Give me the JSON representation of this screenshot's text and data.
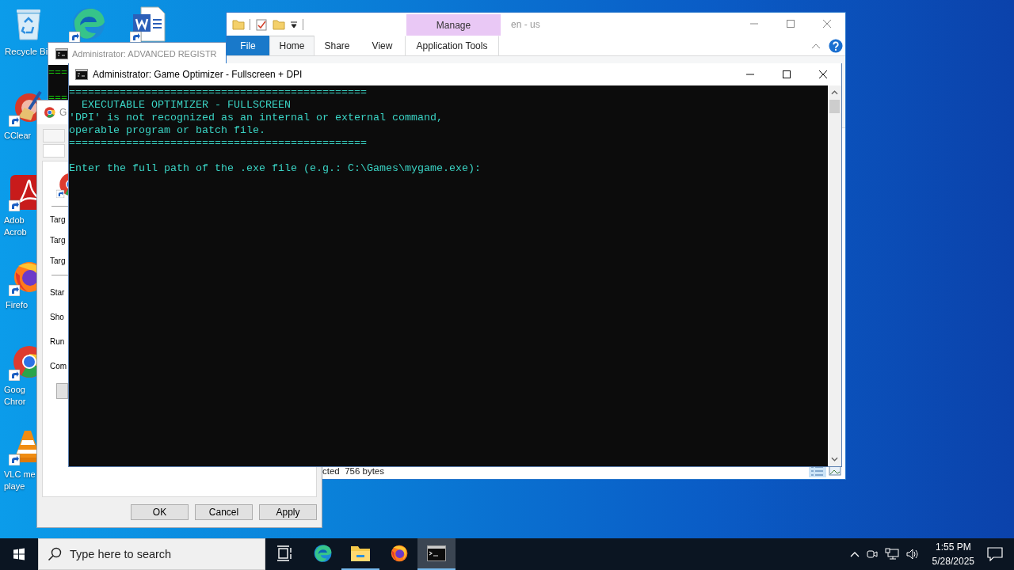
{
  "desktop_icons": [
    {
      "kind": "recycle",
      "lines": [
        "Recycle Bi"
      ]
    },
    {
      "kind": "edge"
    },
    {
      "kind": "word"
    },
    {
      "kind": "ccleaner",
      "lines": [
        "CClear"
      ]
    },
    {
      "kind": "acrobat",
      "lines": [
        "Adob",
        "Acrob"
      ]
    },
    {
      "kind": "firefox",
      "lines": [
        "Firefo"
      ]
    },
    {
      "kind": "chrome",
      "lines": [
        "Goog",
        "Chror"
      ]
    },
    {
      "kind": "vlc",
      "lines": [
        "VLC me",
        "playe"
      ]
    }
  ],
  "explorer": {
    "title": "en - us",
    "contextual_group": "Manage",
    "tabs": [
      {
        "label": "File",
        "kind": "file",
        "selected": false
      },
      {
        "label": "Home",
        "kind": "tab",
        "selected": true
      },
      {
        "label": "Share",
        "kind": "tab",
        "selected": false
      },
      {
        "label": "View",
        "kind": "tab",
        "selected": false
      },
      {
        "label": "Application Tools",
        "kind": "contextual",
        "selected": false
      }
    ],
    "status": "cted  756 bytes"
  },
  "registry_console": {
    "title": "Administrator: ADVANCED REGISTR",
    "lines": [
      "===",
      "==="
    ]
  },
  "properties_dialog": {
    "title": "G",
    "target_fields": [
      "Targ",
      "Targ",
      "Targ"
    ],
    "option_fields": [
      "Star",
      "Sho",
      "Run",
      "Com"
    ],
    "buttons": [
      "OK",
      "Cancel",
      "Apply"
    ]
  },
  "console": {
    "title": "Administrator: Game Optimizer - Fullscreen + DPI",
    "lines": [
      "===============================================",
      "  EXECUTABLE OPTIMIZER - FULLSCREEN",
      "'DPI' is not recognized as an internal or external command,",
      "operable program or batch file.",
      "==============================================="
    ],
    "prompt": "Enter the full path of the .exe file (e.g.: C:\\Games\\mygame.exe):"
  },
  "taskbar": {
    "search": {
      "placeholder": "Type here to search"
    },
    "apps": [
      {
        "kind": "taskview",
        "running": false,
        "selected": false
      },
      {
        "kind": "edge",
        "running": false,
        "selected": false
      },
      {
        "kind": "folder",
        "running": true,
        "selected": false
      },
      {
        "kind": "firefox",
        "running": false,
        "selected": false
      },
      {
        "kind": "cmd",
        "running": true,
        "selected": true
      }
    ],
    "time": "1:55 PM",
    "date": "5/28/2025"
  }
}
